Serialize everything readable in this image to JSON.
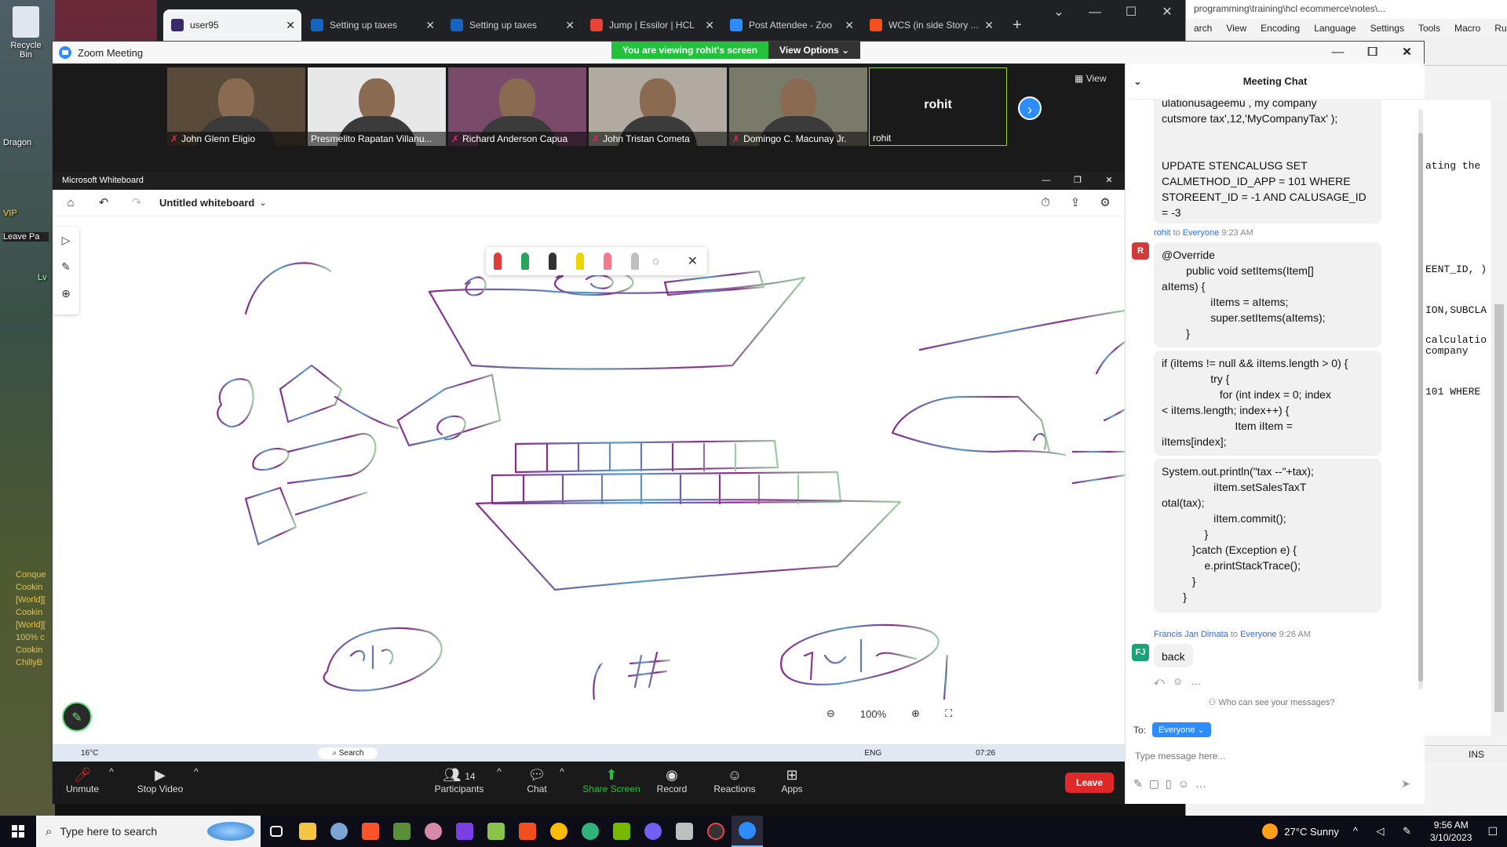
{
  "desktop": {
    "recycle_bin": "Recycle Bin",
    "dragon_label": "Dragon",
    "vip_label": "VIP",
    "leave_label": "Leave Pa",
    "lv_label": "Lv",
    "game_chat": [
      "Conque",
      "Cookin",
      "[World][",
      "Cookin",
      "[World][",
      "100% c",
      "Cookin",
      "ChillyB"
    ]
  },
  "browser": {
    "tabs": [
      {
        "label": "user95",
        "color": "#3b2a6b"
      },
      {
        "label": "Setting up taxes",
        "color": "#1565c0"
      },
      {
        "label": "Setting up taxes",
        "color": "#1565c0"
      },
      {
        "label": "Jump | Essilor | HCL",
        "color": "#ea4335"
      },
      {
        "label": "Post Attendee - Zoo",
        "color": "#2d8cff"
      },
      {
        "label": "WCS (in side Story ...",
        "color": "#f4511e"
      }
    ],
    "new_tab": "+"
  },
  "editor": {
    "path": "programming\\training\\hcl ecommerce\\notes\\...",
    "menu": [
      "arch",
      "View",
      "Encoding",
      "Language",
      "Settings",
      "Tools",
      "Macro",
      "Run"
    ],
    "lines": [
      "ating the",
      "EENT_ID, )",
      "ION,SUBCLA",
      "calculatio",
      "company",
      "101 WHERE"
    ],
    "status": "INS"
  },
  "zoom": {
    "window_title": "Zoom Meeting",
    "viewing_banner": "You are viewing rohit's screen",
    "view_options": "View Options",
    "strip_view": "View",
    "participants": [
      {
        "name": "John Glenn Eligio",
        "muted": true,
        "bg": "#5a4a3a"
      },
      {
        "name": "Presmelito Rapatan Villanu...",
        "muted": false,
        "bg": "#e8e8e8"
      },
      {
        "name": "Richard Anderson Capua",
        "muted": true,
        "bg": "#7a4a6a"
      },
      {
        "name": "John Tristan Cometa",
        "muted": true,
        "bg": "#b0aaa0"
      },
      {
        "name": "Domingo C. Macunay Jr.",
        "muted": true,
        "bg": "#7a7a6a"
      },
      {
        "name": "rohit",
        "muted": false,
        "bg": "#1a1a1a"
      }
    ],
    "rohit_big": "rohit",
    "controls": {
      "unmute": "Unmute",
      "stop_video": "Stop Video",
      "participants": "Participants",
      "participant_count": "14",
      "chat": "Chat",
      "share_screen": "Share Screen",
      "record": "Record",
      "reactions": "Reactions",
      "apps": "Apps",
      "leave": "Leave"
    }
  },
  "whiteboard": {
    "app_title": "Microsoft Whiteboard",
    "board_name": "Untitled whiteboard",
    "zoom_level": "100%",
    "pen_colors": [
      "#e03c3c",
      "#2aa35a",
      "#333333",
      "#f0d400",
      "#f27a8a",
      "#bfbfbf"
    ]
  },
  "inner_taskbar": {
    "temp": "16°C",
    "search": "Search",
    "lang": "ENG",
    "time": "07:26"
  },
  "chat": {
    "title": "Meeting Chat",
    "top_bubble": "ulationusageemu , my company\ncutsmore tax',12,'MyCompanyTax' );\n\n\nUPDATE STENCALUSG SET\nCALMETHOD_ID_APP = 101 WHERE\nSTOREENT_ID = -1 AND CALUSAGE_ID\n= -3",
    "msg1": {
      "sender": "rohit",
      "to_word": "to",
      "audience": "Everyone",
      "time": "9:23 AM",
      "initial": "R",
      "part1": "@Override\n        public void setItems(Item[]\naItems) {\n                iItems = aItems;\n                super.setItems(aItems);\n        }",
      "part2": "if (iItems != null && iItems.length > 0) {\n                try {\n                   for (int index = 0; index\n< iItems.length; index++) {\n                        Item iItem =\niItems[index];",
      "part3": "System.out.println(\"tax --\"+tax);\n                 iItem.setSalesTaxT\notal(tax);\n                 iItem.commit();\n              }\n          }catch (Exception e) {\n              e.printStackTrace();\n          }\n       }"
    },
    "msg2": {
      "sender": "Francis Jan Dimata",
      "to_word": "to",
      "audience": "Everyone",
      "time": "9:26 AM",
      "initial": "FJ",
      "text": "back"
    },
    "who_can_see": "Who can see your messages?",
    "to_label": "To:",
    "to_target": "Everyone",
    "input_placeholder": "Type message here..."
  },
  "taskbar": {
    "search_placeholder": "Type here to search",
    "weather": "27°C  Sunny",
    "time": "9:56 AM",
    "date": "3/10/2023"
  }
}
